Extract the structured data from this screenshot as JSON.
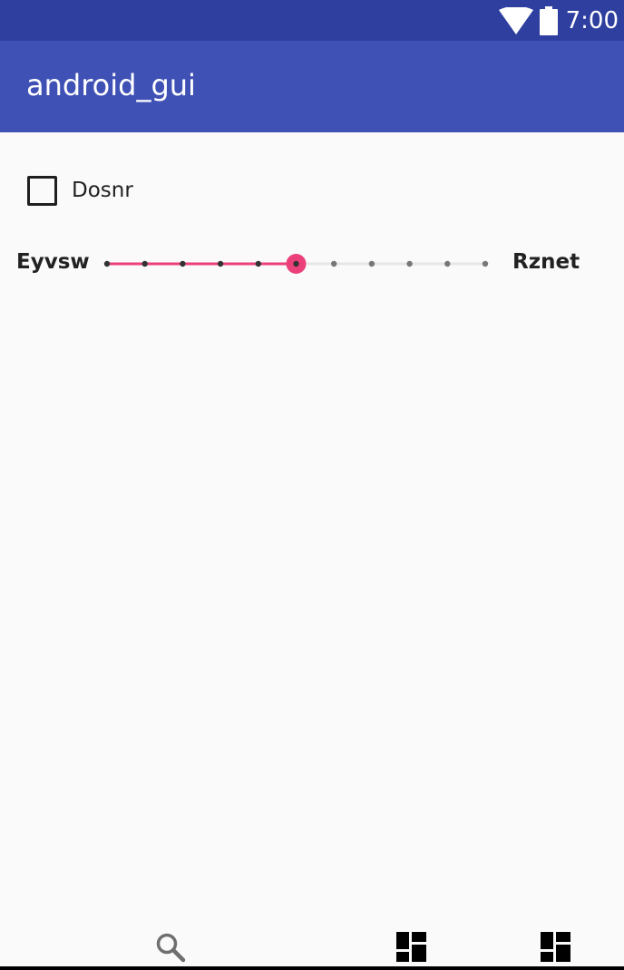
{
  "status_bar": {
    "time": "7:00",
    "icons": [
      "wifi-icon",
      "battery-icon"
    ],
    "color": "#2f3f9f"
  },
  "app_bar": {
    "title": "android_gui",
    "color": "#3f51b5"
  },
  "checkbox": {
    "label": "Dosnr",
    "checked": false
  },
  "seekbar": {
    "min_label": "Eyvsw",
    "max_label": "Rznet",
    "value": 5,
    "max": 10,
    "accent": "#ec407a"
  },
  "bottom_nav": {
    "icons": [
      "search-icon",
      "dashboard-icon",
      "dashboard-icon"
    ]
  }
}
